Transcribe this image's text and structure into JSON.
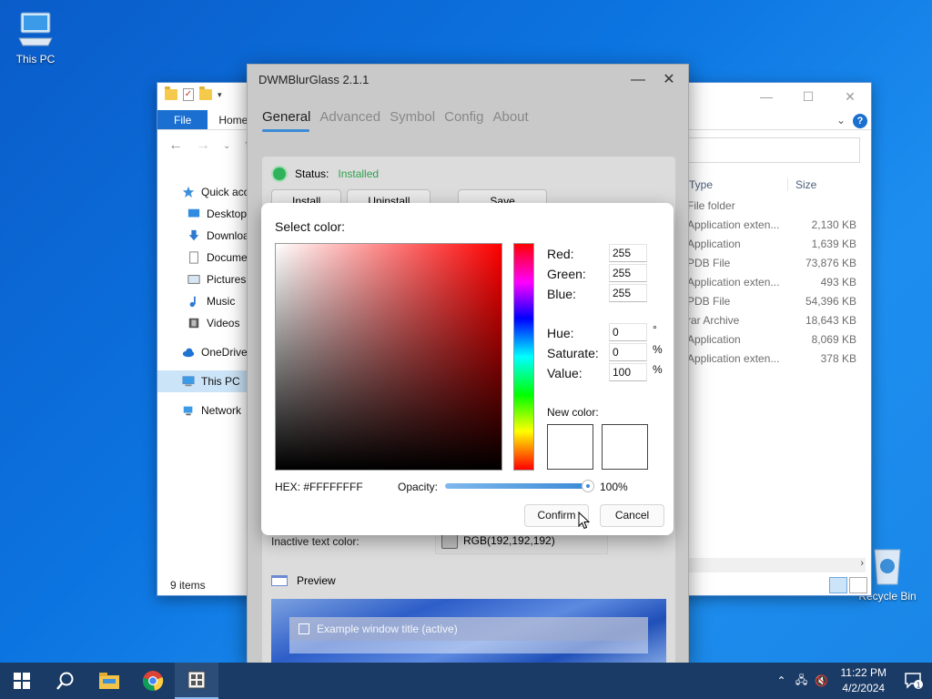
{
  "desktop": {
    "icons": [
      {
        "label": "This PC"
      },
      {
        "label": "Recycle Bin"
      }
    ]
  },
  "explorer": {
    "ribbon": {
      "file_tab": "File",
      "home_tab": "Home"
    },
    "sidebar": {
      "items": [
        {
          "label": "Quick access",
          "icon": "star-icon"
        },
        {
          "label": "Desktop",
          "icon": "desktop-icon"
        },
        {
          "label": "Downloads",
          "icon": "download-icon"
        },
        {
          "label": "Documents",
          "icon": "document-icon"
        },
        {
          "label": "Pictures",
          "icon": "picture-icon"
        },
        {
          "label": "Music",
          "icon": "music-icon"
        },
        {
          "label": "Videos",
          "icon": "video-icon"
        },
        {
          "label": "OneDrive",
          "icon": "cloud-icon"
        },
        {
          "label": "This PC",
          "icon": "computer-icon"
        },
        {
          "label": "Network",
          "icon": "network-icon"
        }
      ]
    },
    "columns": {
      "type": "Type",
      "size": "Size"
    },
    "rows": [
      {
        "type": "File folder",
        "size": ""
      },
      {
        "type": "Application exten...",
        "size": "2,130 KB"
      },
      {
        "type": "Application",
        "size": "1,639 KB"
      },
      {
        "type": "PDB File",
        "size": "73,876 KB"
      },
      {
        "type": "Application exten...",
        "size": "493 KB"
      },
      {
        "type": "PDB File",
        "size": "54,396 KB"
      },
      {
        "type": "rar Archive",
        "size": "18,643 KB"
      },
      {
        "type": "Application",
        "size": "8,069 KB"
      },
      {
        "type": "Application exten...",
        "size": "378 KB"
      }
    ],
    "status": "9 items"
  },
  "dwm": {
    "title": "DWMBlurGlass 2.1.1",
    "tabs": [
      {
        "label": "General"
      },
      {
        "label": "Advanced"
      },
      {
        "label": "Symbol"
      },
      {
        "label": "Config"
      },
      {
        "label": "About"
      }
    ],
    "status_label": "Status:",
    "status_value": "Installed",
    "buttons": {
      "install": "Install",
      "uninstall": "Uninstall",
      "save": "Save"
    },
    "inactive_text_label": "Inactive text color:",
    "inactive_text_value": "RGB(192,192,192)",
    "preview_label": "Preview",
    "preview_window_title": "Example window title (active)"
  },
  "picker": {
    "heading": "Select color:",
    "red_label": "Red:",
    "red": "255",
    "green_label": "Green:",
    "green": "255",
    "blue_label": "Blue:",
    "blue": "255",
    "hue_label": "Hue:",
    "hue": "0",
    "hue_unit": "°",
    "saturate_label": "Saturate:",
    "saturate": "0",
    "saturate_unit": "%",
    "value_label": "Value:",
    "value": "100",
    "value_unit": "%",
    "new_color_label": "New color:",
    "hex": "HEX: #FFFFFFFF",
    "opacity_label": "Opacity:",
    "opacity_value": "100%",
    "opacity_fraction": 1.0,
    "confirm": "Confirm",
    "cancel": "Cancel"
  },
  "taskbar": {
    "time": "11:22 PM",
    "date": "4/2/2024",
    "notification_count": "1"
  }
}
